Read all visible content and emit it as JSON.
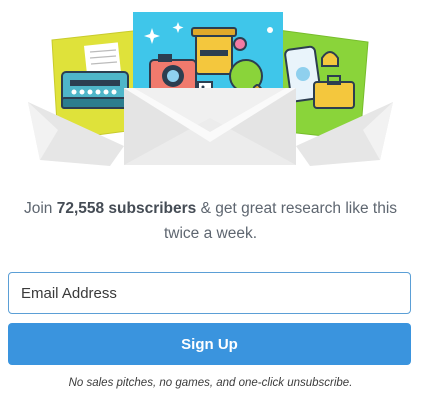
{
  "hero": {
    "illustration_icon": "envelopes-with-collage-illustration",
    "colors": {
      "left_card": "#dfe23a",
      "center_card": "#3fc6ea",
      "right_card": "#8ad43a",
      "envelope": "#eeeeee"
    }
  },
  "tagline": {
    "prefix": "Join ",
    "count": "72,558 subscribers",
    "suffix": " & get great research like this twice a week."
  },
  "form": {
    "email_placeholder": "Email Address",
    "email_value": "",
    "submit_label": "Sign Up",
    "button_color": "#3a94de"
  },
  "disclaimer": "No sales pitches, no games, and one-click unsubscribe."
}
